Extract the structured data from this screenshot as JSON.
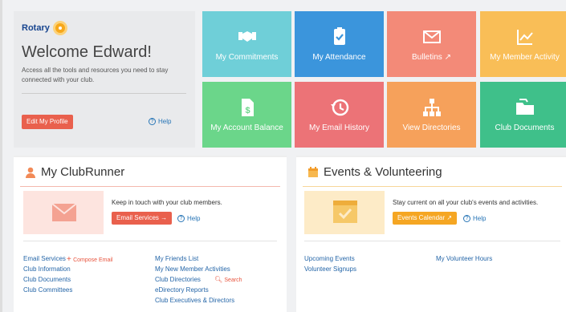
{
  "brand": {
    "name": "Rotary"
  },
  "welcome": {
    "title": "Welcome Edward!",
    "subtitle": "Access all the tools and resources you need to stay connected with your club.",
    "edit_profile": "Edit My Profile",
    "help": "Help"
  },
  "tiles": [
    {
      "label": "My Commitments",
      "color": "#6fcfd8",
      "icon": "handshake-icon"
    },
    {
      "label": "My Attendance",
      "color": "#3b95dc",
      "icon": "clipboard-check-icon"
    },
    {
      "label": "Bulletins",
      "color": "#f38a78",
      "icon": "envelope-icon"
    },
    {
      "label": "My Member Activity",
      "color": "#f9be57",
      "icon": "chart-line-icon"
    },
    {
      "label": "My Account Balance",
      "color": "#6bd68a",
      "icon": "dollar-document-icon"
    },
    {
      "label": "My Email History",
      "color": "#ec7377",
      "icon": "history-icon"
    },
    {
      "label": "View Directories",
      "color": "#f6a15b",
      "icon": "sitemap-icon"
    },
    {
      "label": "Club Documents",
      "color": "#3fc08a",
      "icon": "folder-icon"
    }
  ],
  "clubrunner": {
    "title": "My ClubRunner",
    "intro": "Keep in touch with your club members.",
    "email_services": "Email Services",
    "help": "Help",
    "left_links": [
      "Email Services",
      "Club Information",
      "Club Documents",
      "Club Committees"
    ],
    "compose": "Compose Email",
    "right_links": [
      "My Friends List",
      "My New Member Activities",
      "Club Directories",
      "eDirectory Reports",
      "Club Executives & Directors"
    ],
    "search": "Search"
  },
  "events": {
    "title": "Events & Volunteering",
    "intro": "Stay current on all your club's events and activities.",
    "calendar": "Events Calendar",
    "help": "Help",
    "left_links": [
      "Upcoming Events",
      "Volunteer Signups"
    ],
    "right_links": [
      "My Volunteer Hours"
    ]
  }
}
